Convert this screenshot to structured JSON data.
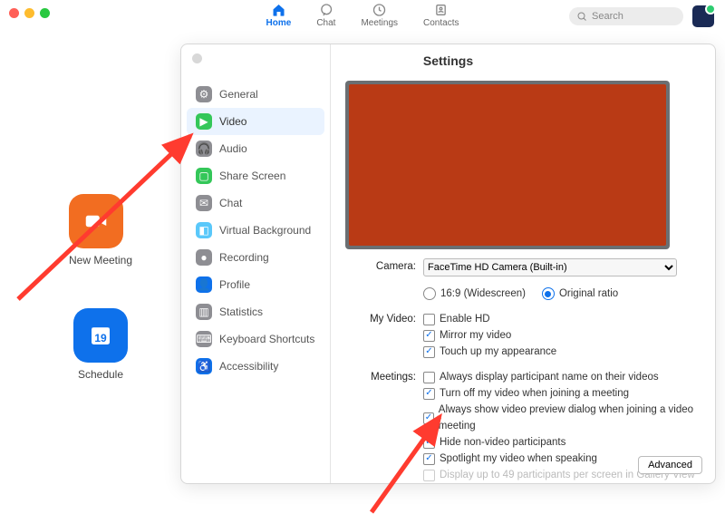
{
  "nav": {
    "home": "Home",
    "chat": "Chat",
    "meetings": "Meetings",
    "contacts": "Contacts",
    "search_placeholder": "Search"
  },
  "main": {
    "new_meeting": "New Meeting",
    "schedule": "Schedule",
    "cal_day": "19"
  },
  "settings": {
    "title": "Settings",
    "sidebar": [
      "General",
      "Video",
      "Audio",
      "Share Screen",
      "Chat",
      "Virtual Background",
      "Recording",
      "Profile",
      "Statistics",
      "Keyboard Shortcuts",
      "Accessibility"
    ],
    "camera_label": "Camera:",
    "camera_value": "FaceTime HD Camera (Built-in)",
    "ratio_169": "16:9 (Widescreen)",
    "ratio_orig": "Original ratio",
    "myvideo_label": "My Video:",
    "enable_hd": "Enable HD",
    "mirror": "Mirror my video",
    "touchup": "Touch up my appearance",
    "meetings_label": "Meetings:",
    "m1": "Always display participant name on their videos",
    "m2": "Turn off my video when joining a meeting",
    "m3": "Always show video preview dialog when joining a video meeting",
    "m4": "Hide non-video participants",
    "m5": "Spotlight my video when speaking",
    "m6": "Display up to 49 participants per screen in Gallery View",
    "advanced": "Advanced"
  },
  "sidebar_colors": [
    "#8e8e93",
    "#34c759",
    "#8e8e93",
    "#34c759",
    "#8e8e93",
    "#5ac8fa",
    "#8e8e93",
    "#0e71eb",
    "#8e8e93",
    "#8e8e93",
    "#0e71eb"
  ]
}
